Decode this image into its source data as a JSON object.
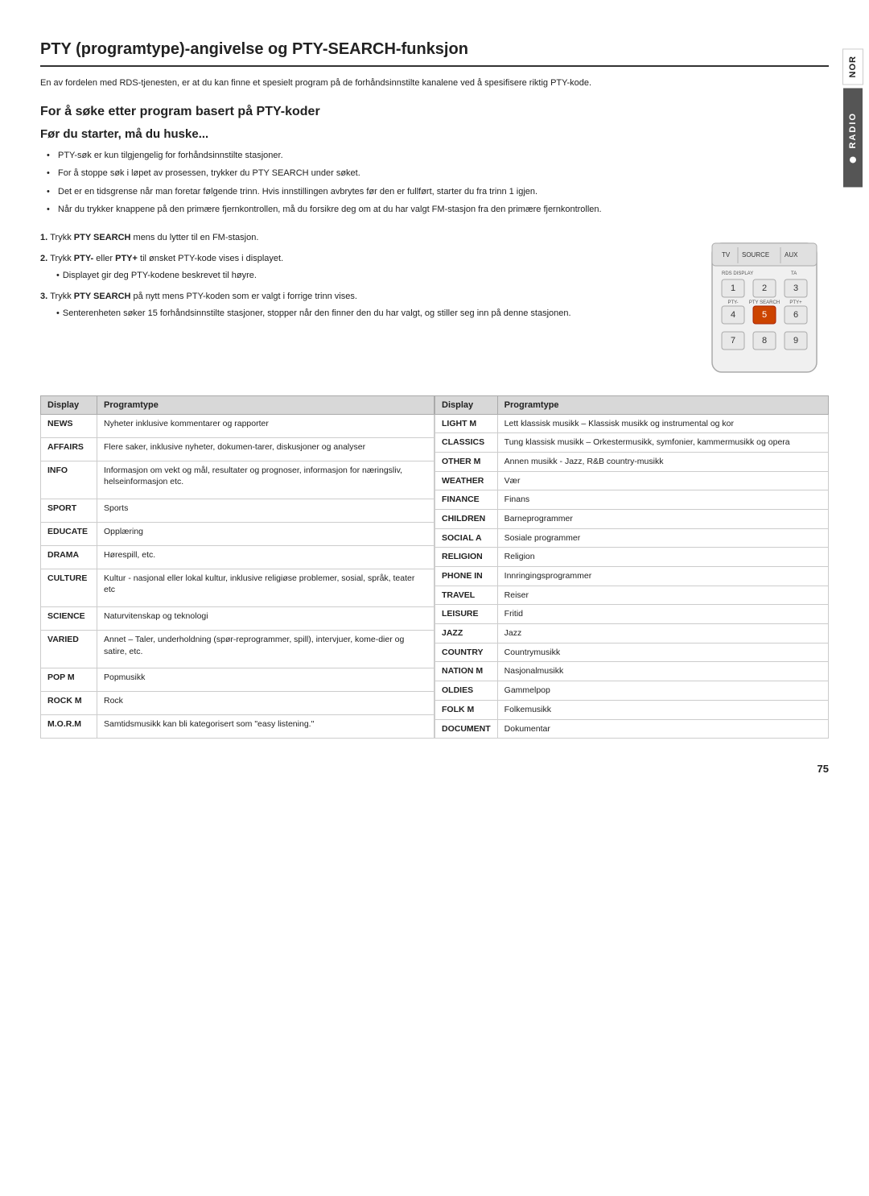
{
  "page": {
    "title": "PTY (programtype)-angivelse og PTY-SEARCH-funksjon",
    "intro": "En av fordelen med RDS-tjenesten, er at du kan finne et spesielt program på de forhåndsinnstilte kanalene ved å spesifisere riktig PTY-kode.",
    "section_title": "For å søke etter program basert på PTY-koder",
    "subsection_title": "Før du starter, må du huske...",
    "bullets": [
      "PTY-søk er kun tilgjengelig for forhåndsinnstilte stasjoner.",
      "For å stoppe søk i løpet av prosessen, trykker du PTY SEARCH under søket.",
      "Det er en tidsgrense når man foretar følgende trinn. Hvis innstillingen avbrytes før den er fullført, starter du fra trinn 1 igjen.",
      "Når du trykker knappene på den primære fjernkontrollen, må du forsikre deg om at du har valgt FM-stasjon fra den primære fjernkontrollen."
    ],
    "steps": [
      {
        "num": "1.",
        "bold_part": "PTY SEARCH",
        "text": " mens du lytter til en FM-stasjon."
      },
      {
        "num": "2.",
        "bold_part": "PTY-",
        "text": " eller ",
        "bold_part2": "PTY+",
        "text2": " til ønsket PTY-kode vises i displayet.",
        "sub": "Displayet gir deg PTY-kodene beskrevet til høyre."
      },
      {
        "num": "3.",
        "bold_part": "PTY SEARCH",
        "text": " på nytt mens PTY-koden som er valgt i forrige trinn vises.",
        "subs": [
          "Senterenheten søker 15 forhåndsinnstilte stasjoner, stopper når den finner den du har valgt, og stiller seg inn på denne stasjonen."
        ]
      }
    ],
    "step1_prefix": "Trykk ",
    "step2_prefix": "Trykk ",
    "step3_prefix": "Trykk ",
    "table_left": {
      "col1": "Display",
      "col2": "Programtype",
      "rows": [
        {
          "display": "NEWS",
          "programtype": "Nyheter inklusive kommentarer og rapporter"
        },
        {
          "display": "AFFAIRS",
          "programtype": "Flere saker, inklusive nyheter, dokumen-tarer, diskusjoner og analyser"
        },
        {
          "display": "INFO",
          "programtype": "Informasjon om vekt og mål, resultater og prognoser, informasjon for næringsliv, helseinformasjon etc."
        },
        {
          "display": "SPORT",
          "programtype": "Sports"
        },
        {
          "display": "EDUCATE",
          "programtype": "Opplæring"
        },
        {
          "display": "DRAMA",
          "programtype": "Hørespill, etc."
        },
        {
          "display": "CULTURE",
          "programtype": "Kultur - nasjonal eller lokal kultur, inklusive religiøse problemer, sosial, språk, teater etc"
        },
        {
          "display": "SCIENCE",
          "programtype": "Naturvitenskap og teknologi"
        },
        {
          "display": "VARIED",
          "programtype": "Annet – Taler, underholdning (spør-reprogrammer, spill), intervjuer, kome-dier og satire, etc."
        },
        {
          "display": "POP M",
          "programtype": "Popmusikk"
        },
        {
          "display": "ROCK M",
          "programtype": "Rock"
        },
        {
          "display": "M.O.R.M",
          "programtype": "Samtidsmusikk kan bli kategorisert som \"easy listening.\""
        }
      ]
    },
    "table_right": {
      "col1": "Display",
      "col2": "Programtype",
      "rows": [
        {
          "display": "LIGHT M",
          "programtype": "Lett klassisk musikk – Klassisk musikk og instrumental og kor"
        },
        {
          "display": "CLASSICS",
          "programtype": "Tung klassisk musikk – Orkestermusikk, symfonier, kammermusikk og opera"
        },
        {
          "display": "OTHER M",
          "programtype": "Annen musikk - Jazz, R&B country-musikk"
        },
        {
          "display": "WEATHER",
          "programtype": "Vær"
        },
        {
          "display": "FINANCE",
          "programtype": "Finans"
        },
        {
          "display": "CHILDREN",
          "programtype": "Barneprogrammer"
        },
        {
          "display": "SOCIAL A",
          "programtype": "Sosiale programmer"
        },
        {
          "display": "RELIGION",
          "programtype": "Religion"
        },
        {
          "display": "PHONE IN",
          "programtype": "Innringingsprogrammer"
        },
        {
          "display": "TRAVEL",
          "programtype": "Reiser"
        },
        {
          "display": "LEISURE",
          "programtype": "Fritid"
        },
        {
          "display": "JAZZ",
          "programtype": "Jazz"
        },
        {
          "display": "COUNTRY",
          "programtype": "Countrymusikk"
        },
        {
          "display": "NATION M",
          "programtype": "Nasjonalmusikk"
        },
        {
          "display": "OLDIES",
          "programtype": "Gammelpop"
        },
        {
          "display": "FOLK M",
          "programtype": "Folkemusikk"
        },
        {
          "display": "DOCUMENT",
          "programtype": "Dokumentar"
        }
      ]
    },
    "page_number": "75",
    "side_tab_nor": "NOR",
    "side_tab_radio": "RADIO"
  }
}
